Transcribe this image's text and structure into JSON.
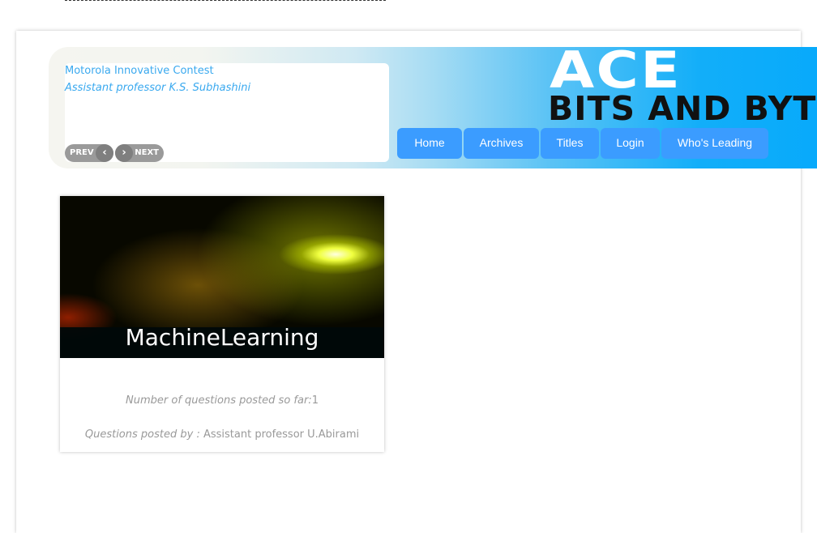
{
  "news": {
    "title": "Motorola Innovative Contest",
    "author": "Assistant professor K.S. Subhashini",
    "prev": "PREV",
    "next": "NEXT"
  },
  "logo": {
    "line1": "ACE",
    "line2": "BITS AND BYTE"
  },
  "nav": [
    "Home",
    "Archives",
    "Titles",
    "Login",
    "Who's Leading"
  ],
  "card": {
    "title": "MachineLearning",
    "count_label": "Number of questions posted so far:",
    "count": "1",
    "by_label": "Questions posted by :",
    "by": "Assistant professor U.Abirami"
  }
}
